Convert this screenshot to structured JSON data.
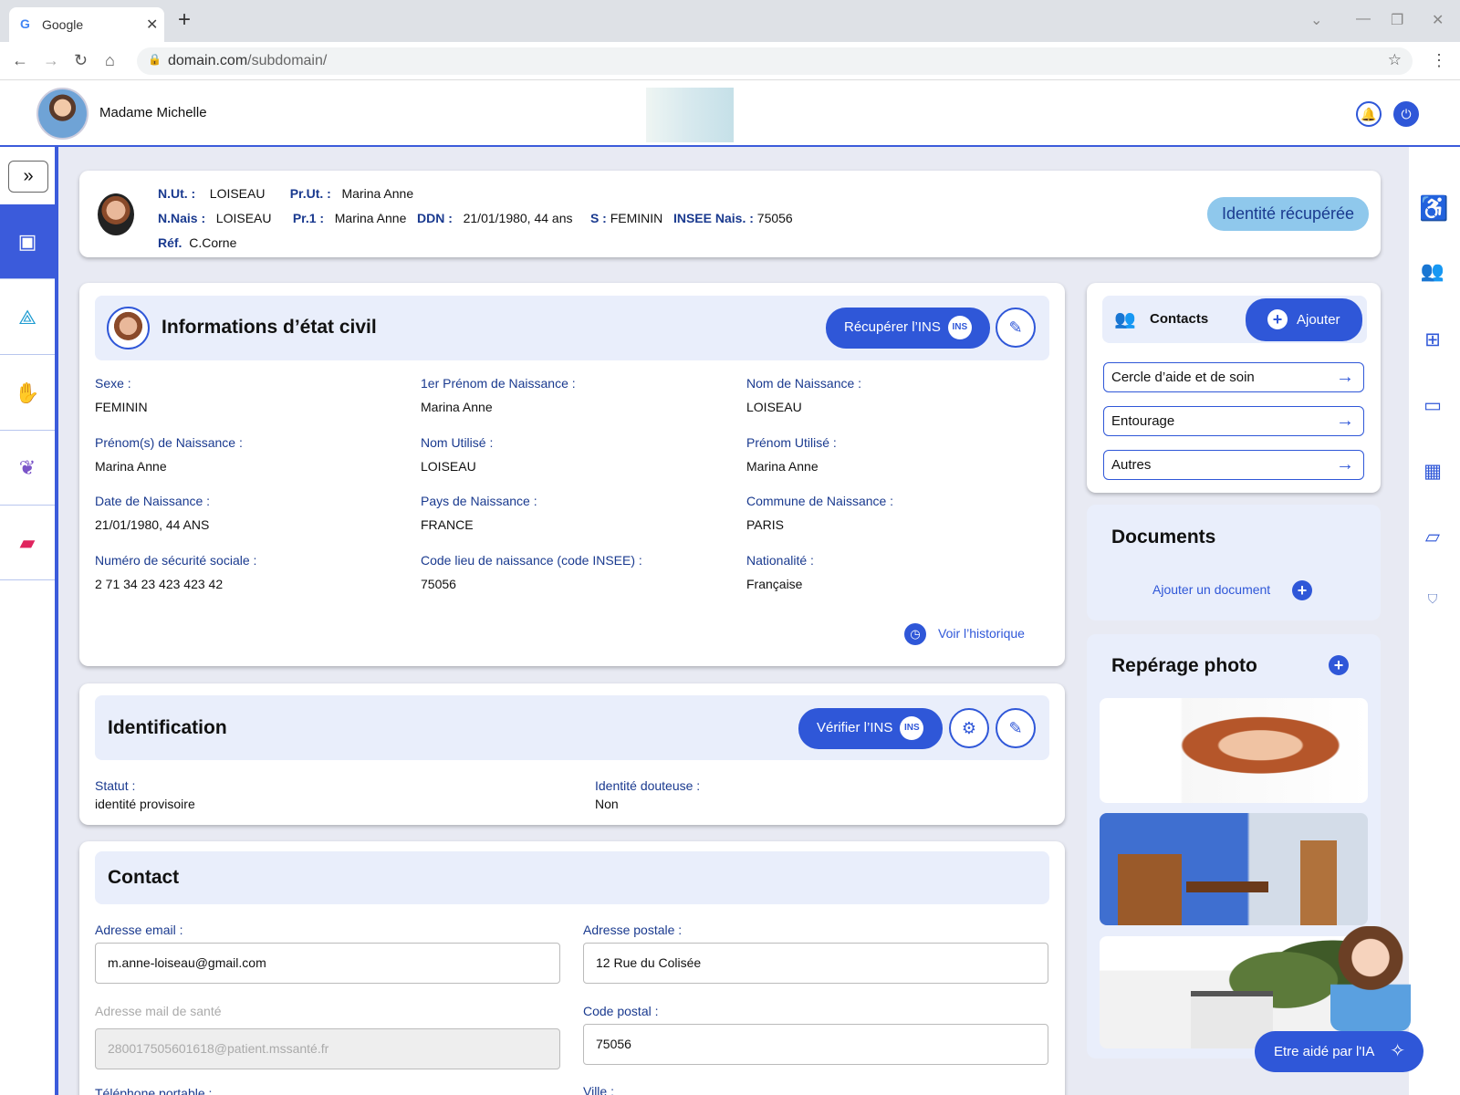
{
  "browser": {
    "tab_title": "Google",
    "url_host": "domain.com",
    "url_path": "/subdomain/"
  },
  "header": {
    "user_name": "Madame Michelle"
  },
  "banner": {
    "nut_label": "N.Ut. :",
    "nut_value": "LOISEAU",
    "prut_label": "Pr.Ut. :",
    "prut_value": "Marina Anne",
    "nnais_label": "N.Nais :",
    "nnais_value": "LOISEAU",
    "pr1_label": "Pr.1 :",
    "pr1_value": "Marina Anne",
    "ddn_label": "DDN :",
    "ddn_value": "21/01/1980, 44 ans",
    "s_label": "S :",
    "s_value": "FEMININ",
    "insee_label": "INSEE Nais. :",
    "insee_value": "75056",
    "ref_label": "Réf.",
    "ref_value": "C.Corne",
    "status_pill": "Identité récupérée"
  },
  "civil": {
    "title": "Informations d’état civil",
    "recover_btn": "Récupérer l’INS",
    "fields": [
      {
        "label": "Sexe :",
        "value": "FEMININ"
      },
      {
        "label": "1er Prénom de Naissance :",
        "value": "Marina Anne"
      },
      {
        "label": "Nom de Naissance :",
        "value": "LOISEAU"
      },
      {
        "label": "Prénom(s) de Naissance :",
        "value": "Marina Anne"
      },
      {
        "label": "Nom Utilisé :",
        "value": "LOISEAU"
      },
      {
        "label": "Prénom Utilisé :",
        "value": "Marina Anne"
      },
      {
        "label": "Date de Naissance :",
        "value": "21/01/1980, 44 ANS"
      },
      {
        "label": "Pays de Naissance :",
        "value": "FRANCE"
      },
      {
        "label": "Commune de Naissance :",
        "value": "PARIS"
      },
      {
        "label": "Numéro de sécurité sociale :",
        "value": "2 71 34 23 423 423 42"
      },
      {
        "label": "Code lieu de naissance (code INSEE) :",
        "value": "75056"
      },
      {
        "label": "Nationalité :",
        "value": "Française"
      }
    ],
    "history_link": "Voir l’historique"
  },
  "identification": {
    "title": "Identification",
    "verify_btn": "Vérifier l’INS",
    "statut_label": "Statut :",
    "statut_value": "identité provisoire",
    "douteuse_label": "Identité douteuse :",
    "douteuse_value": "Non"
  },
  "contact": {
    "title": "Contact",
    "email_label": "Adresse email :",
    "email_value": "m.anne-loiseau@gmail.com",
    "postal_label": "Adresse postale :",
    "postal_value": "12 Rue du Colisée",
    "health_mail_label": "Adresse mail de santé",
    "health_mail_placeholder": "280017505601618@patient.mssanté.fr",
    "zip_label": "Code postal :",
    "zip_value": "75056",
    "mobile_label": "Téléphone portable :",
    "city_label": "Ville :"
  },
  "contacts_panel": {
    "title": "Contacts",
    "add_btn": "Ajouter",
    "links": [
      "Cercle d’aide et de soin",
      "Entourage",
      "Autres"
    ]
  },
  "documents": {
    "title": "Documents",
    "add_link": "Ajouter un document"
  },
  "photos": {
    "title": "Repérage photo"
  },
  "ai": {
    "button": "Etre aidé par l'IA"
  },
  "icons": {
    "left_sidebar": [
      "contact-card-icon",
      "network-icon",
      "hand-icon",
      "lotus-icon",
      "vitals-icon"
    ],
    "right_sidebar": [
      "accessibility-icon",
      "group-icon",
      "medical-id-icon",
      "chat-icon",
      "calendar-icon",
      "folder-icon",
      "dmp-icon"
    ]
  },
  "colors": {
    "accent": "#2f57d8",
    "section_bg": "#e9eefb",
    "pill_bg": "#8fc8ec",
    "label": "#1a3a8f"
  }
}
